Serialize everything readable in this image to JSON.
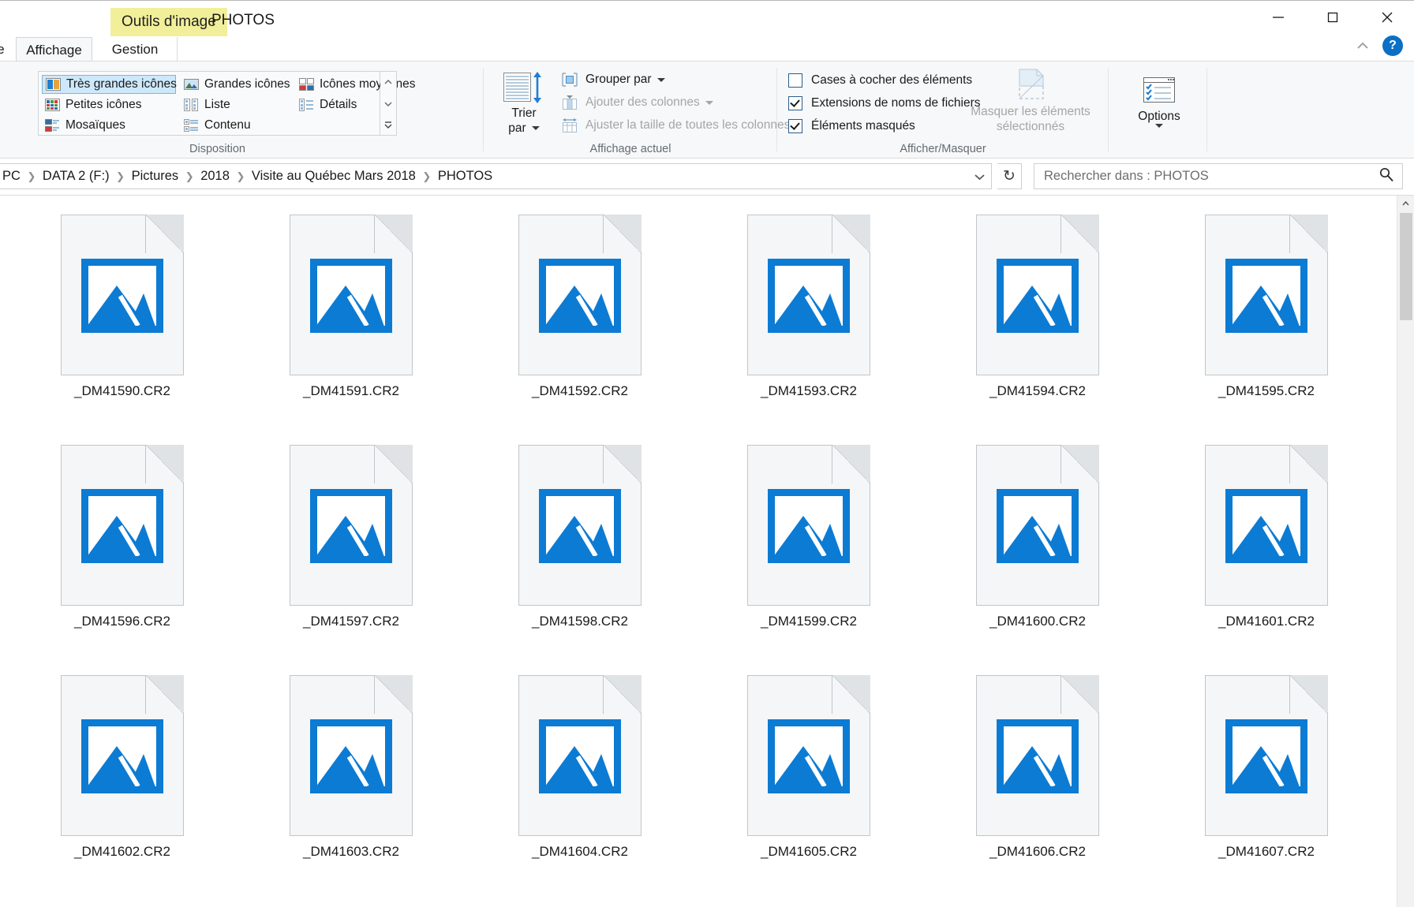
{
  "window": {
    "contextual_tab_label": "Outils d'image",
    "title": "PHOTOS",
    "minimize_label": "Réduire",
    "maximize_label": "Agrandir",
    "close_label": "Fermer",
    "collapse_ribbon_label": "Réduire le ruban",
    "help_label": "?"
  },
  "tabs": [
    {
      "label": "e",
      "state": "partial"
    },
    {
      "label": "Affichage",
      "state": "active"
    },
    {
      "label": "Gestion",
      "state": "contextual"
    }
  ],
  "ribbon": {
    "groups": [
      {
        "label": "Disposition"
      },
      {
        "label": "Affichage actuel"
      },
      {
        "label": "Afficher/Masquer"
      }
    ],
    "layout_gallery": {
      "items": [
        {
          "label": "Très grandes icônes",
          "icon": "very-large-icons-icon",
          "selected": true
        },
        {
          "label": "Grandes icônes",
          "icon": "large-icons-icon",
          "selected": false
        },
        {
          "label": "Icônes moyennes",
          "icon": "medium-icons-icon",
          "selected": false
        },
        {
          "label": "Petites icônes",
          "icon": "small-icons-icon",
          "selected": false
        },
        {
          "label": "Liste",
          "icon": "list-view-icon",
          "selected": false
        },
        {
          "label": "Détails",
          "icon": "details-view-icon",
          "selected": false
        },
        {
          "label": "Mosaïques",
          "icon": "tiles-view-icon",
          "selected": false
        },
        {
          "label": "Contenu",
          "icon": "content-view-icon",
          "selected": false
        }
      ]
    },
    "current_view": {
      "sort_by_line1": "Trier",
      "sort_by_line2": "par",
      "group_by": "Grouper par",
      "add_columns": "Ajouter des colonnes",
      "size_all_columns": "Ajuster la taille de toutes les colonnes"
    },
    "show_hide": {
      "item_checkboxes": {
        "label": "Cases à cocher des éléments",
        "checked": false
      },
      "file_name_extensions": {
        "label": "Extensions de noms de fichiers",
        "checked": true
      },
      "hidden_items": {
        "label": "Éléments masqués",
        "checked": true
      },
      "hide_selected_line1": "Masquer les éléments",
      "hide_selected_line2": "sélectionnés",
      "options_label": "Options"
    }
  },
  "address": {
    "breadcrumbs": [
      "PC",
      "DATA 2 (F:)",
      "Pictures",
      "2018",
      "Visite au Québec Mars 2018",
      "PHOTOS"
    ],
    "separator": "❯",
    "dropdown_icon": "chevron-down-icon",
    "refresh_icon": "↻",
    "search_placeholder": "Rechercher dans : PHOTOS",
    "search_value": "",
    "search_icon": "search-icon"
  },
  "files": [
    {
      "name": "_DM41590.CR2",
      "icon": "image-file-icon"
    },
    {
      "name": "_DM41591.CR2",
      "icon": "image-file-icon"
    },
    {
      "name": "_DM41592.CR2",
      "icon": "image-file-icon"
    },
    {
      "name": "_DM41593.CR2",
      "icon": "image-file-icon"
    },
    {
      "name": "_DM41594.CR2",
      "icon": "image-file-icon"
    },
    {
      "name": "_DM41595.CR2",
      "icon": "image-file-icon"
    },
    {
      "name": "_DM41596.CR2",
      "icon": "image-file-icon"
    },
    {
      "name": "_DM41597.CR2",
      "icon": "image-file-icon"
    },
    {
      "name": "_DM41598.CR2",
      "icon": "image-file-icon"
    },
    {
      "name": "_DM41599.CR2",
      "icon": "image-file-icon"
    },
    {
      "name": "_DM41600.CR2",
      "icon": "image-file-icon"
    },
    {
      "name": "_DM41601.CR2",
      "icon": "image-file-icon"
    },
    {
      "name": "_DM41602.CR2",
      "icon": "image-file-icon"
    },
    {
      "name": "_DM41603.CR2",
      "icon": "image-file-icon"
    },
    {
      "name": "_DM41604.CR2",
      "icon": "image-file-icon"
    },
    {
      "name": "_DM41605.CR2",
      "icon": "image-file-icon"
    },
    {
      "name": "_DM41606.CR2",
      "icon": "image-file-icon"
    },
    {
      "name": "_DM41607.CR2",
      "icon": "image-file-icon"
    }
  ],
  "colors": {
    "accent_blue": "#0c7bd4",
    "contextual_yellow": "#f2ef9b",
    "selection_blue": "#cde8fa",
    "ribbon_bg": "#f6f8f9",
    "help_blue": "#0b6fc4"
  }
}
